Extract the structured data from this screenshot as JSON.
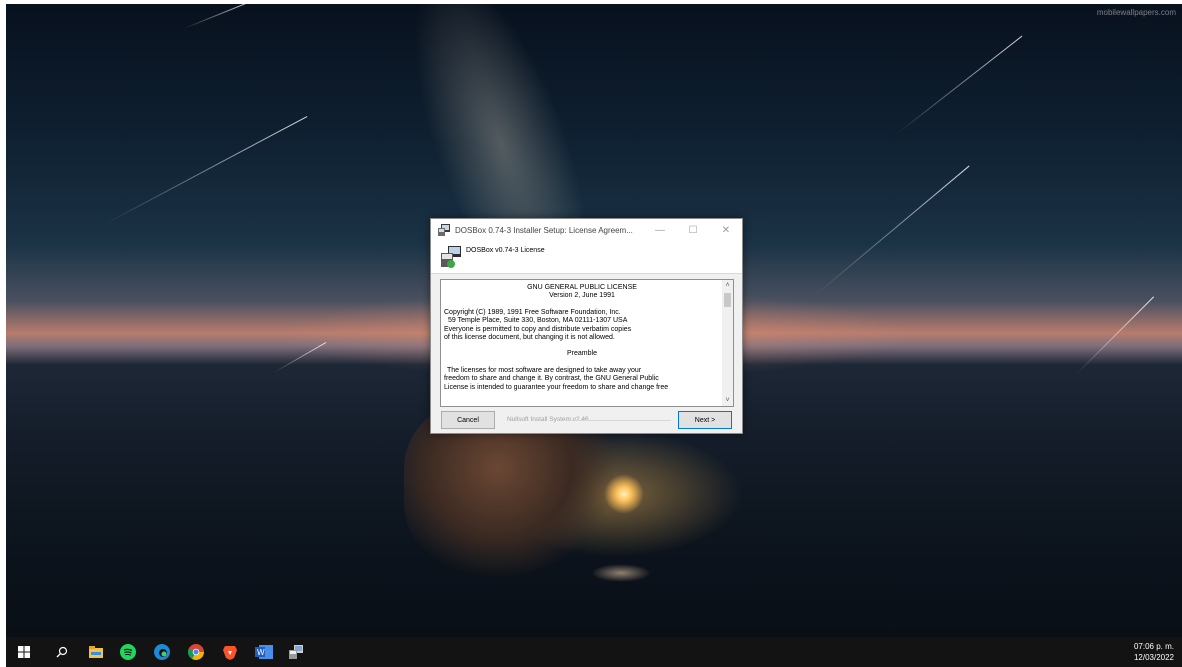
{
  "desktop": {
    "watermark": "mobilewallpapers.com"
  },
  "installer": {
    "title": "DOSBox 0.74-3 Installer Setup: License Agreem...",
    "header_title": "DOSBox v0.74-3 License",
    "license_lines": {
      "l1": "GNU GENERAL PUBLIC LICENSE",
      "l2": "Version 2, June 1991",
      "l3": "Copyright (C) 1989, 1991 Free Software Foundation, Inc.",
      "l4": "59 Temple Place, Suite 330, Boston, MA  02111-1307  USA",
      "l5": "Everyone is permitted to copy and distribute verbatim copies",
      "l6": "of this license document, but changing it is not allowed.",
      "l7": "Preamble",
      "l8": "The licenses for most software are designed to take away your",
      "l9": "freedom to share and change it.  By contrast, the GNU General Public",
      "l10": "License is intended to guarantee your freedom to share and change free"
    },
    "cancel_label": "Cancel",
    "branding": "Nullsoft Install System v2.46",
    "next_label": "Next >",
    "minimize_glyph": "—",
    "maximize_glyph": "☐",
    "close_glyph": "✕",
    "scroll_up_glyph": "˄",
    "scroll_down_glyph": "˅"
  },
  "taskbar": {
    "icons": [
      "windows-start-icon",
      "search-icon",
      "file-explorer-icon",
      "spotify-icon",
      "edge-icon",
      "chrome-icon",
      "brave-icon",
      "word-icon",
      "dosbox-installer-icon"
    ],
    "time": "07:06 p. m.",
    "date": "12/03/2022"
  },
  "colors": {
    "taskbar_bg": "#131313",
    "dialog_bg": "#f0f0f0",
    "accent": "#0078d7"
  }
}
